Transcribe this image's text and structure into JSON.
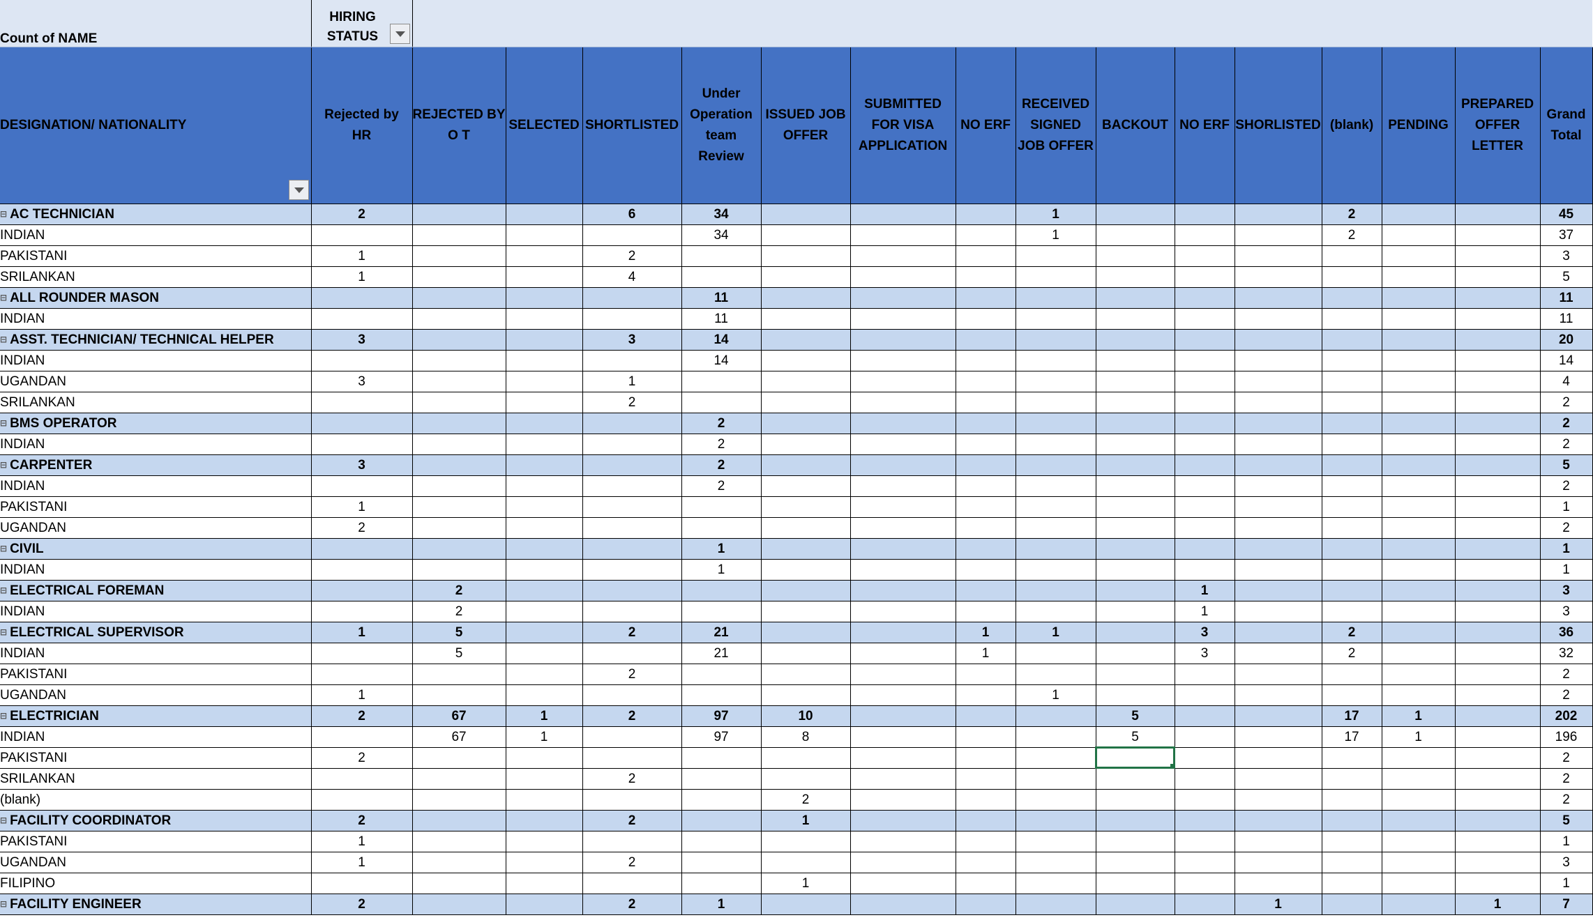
{
  "pivot": {
    "count_label": "Count of NAME",
    "status_label": [
      "HIRING",
      "STATUS"
    ],
    "row_header": "DESIGNATION/ NATIONALITY",
    "columns": [
      [
        "Rejected by",
        "HR"
      ],
      [
        "REJECTED BY",
        "O T"
      ],
      [
        "SELECTED"
      ],
      [
        "SHORTLISTED"
      ],
      [
        "Under",
        "Operation",
        "team",
        "Review"
      ],
      [
        "ISSUED JOB",
        "OFFER"
      ],
      [
        "SUBMITTED",
        "FOR VISA",
        "APPLICATION"
      ],
      [
        "NO ERF"
      ],
      [
        "RECEIVED",
        "SIGNED",
        "JOB OFFER"
      ],
      [
        "BACKOUT"
      ],
      [
        "NO ERF"
      ],
      [
        "SHORLISTED"
      ],
      [
        "(blank)"
      ],
      [
        "PENDING"
      ],
      [
        "PREPARED",
        "OFFER",
        "LETTER"
      ],
      [
        "Grand",
        "Total"
      ]
    ],
    "rows": [
      {
        "type": "group",
        "label": "AC TECHNICIAN",
        "cells": [
          "2",
          "",
          "",
          "6",
          "34",
          "",
          "",
          "",
          "1",
          "",
          "",
          "",
          "2",
          "",
          "",
          "45"
        ]
      },
      {
        "type": "sub",
        "label": "INDIAN",
        "cells": [
          "",
          "",
          "",
          "",
          "34",
          "",
          "",
          "",
          "1",
          "",
          "",
          "",
          "2",
          "",
          "",
          "37"
        ]
      },
      {
        "type": "sub",
        "label": "PAKISTANI",
        "cells": [
          "1",
          "",
          "",
          "2",
          "",
          "",
          "",
          "",
          "",
          "",
          "",
          "",
          "",
          "",
          "",
          "3"
        ]
      },
      {
        "type": "sub",
        "label": "SRILANKAN",
        "cells": [
          "1",
          "",
          "",
          "4",
          "",
          "",
          "",
          "",
          "",
          "",
          "",
          "",
          "",
          "",
          "",
          "5"
        ]
      },
      {
        "type": "group",
        "label": "ALL ROUNDER MASON",
        "cells": [
          "",
          "",
          "",
          "",
          "11",
          "",
          "",
          "",
          "",
          "",
          "",
          "",
          "",
          "",
          "",
          "11"
        ]
      },
      {
        "type": "sub",
        "label": "INDIAN",
        "cells": [
          "",
          "",
          "",
          "",
          "11",
          "",
          "",
          "",
          "",
          "",
          "",
          "",
          "",
          "",
          "",
          "11"
        ]
      },
      {
        "type": "group",
        "label": "ASST. TECHNICIAN/ TECHNICAL HELPER",
        "cells": [
          "3",
          "",
          "",
          "3",
          "14",
          "",
          "",
          "",
          "",
          "",
          "",
          "",
          "",
          "",
          "",
          "20"
        ]
      },
      {
        "type": "sub",
        "label": "INDIAN",
        "cells": [
          "",
          "",
          "",
          "",
          "14",
          "",
          "",
          "",
          "",
          "",
          "",
          "",
          "",
          "",
          "",
          "14"
        ]
      },
      {
        "type": "sub",
        "label": "UGANDAN",
        "cells": [
          "3",
          "",
          "",
          "1",
          "",
          "",
          "",
          "",
          "",
          "",
          "",
          "",
          "",
          "",
          "",
          "4"
        ]
      },
      {
        "type": "sub",
        "label": "SRILANKAN",
        "cells": [
          "",
          "",
          "",
          "2",
          "",
          "",
          "",
          "",
          "",
          "",
          "",
          "",
          "",
          "",
          "",
          "2"
        ]
      },
      {
        "type": "group",
        "label": "BMS OPERATOR",
        "cells": [
          "",
          "",
          "",
          "",
          "2",
          "",
          "",
          "",
          "",
          "",
          "",
          "",
          "",
          "",
          "",
          "2"
        ]
      },
      {
        "type": "sub",
        "label": "INDIAN",
        "cells": [
          "",
          "",
          "",
          "",
          "2",
          "",
          "",
          "",
          "",
          "",
          "",
          "",
          "",
          "",
          "",
          "2"
        ]
      },
      {
        "type": "group",
        "label": "CARPENTER",
        "cells": [
          "3",
          "",
          "",
          "",
          "2",
          "",
          "",
          "",
          "",
          "",
          "",
          "",
          "",
          "",
          "",
          "5"
        ]
      },
      {
        "type": "sub",
        "label": "INDIAN",
        "cells": [
          "",
          "",
          "",
          "",
          "2",
          "",
          "",
          "",
          "",
          "",
          "",
          "",
          "",
          "",
          "",
          "2"
        ]
      },
      {
        "type": "sub",
        "label": "PAKISTANI",
        "cells": [
          "1",
          "",
          "",
          "",
          "",
          "",
          "",
          "",
          "",
          "",
          "",
          "",
          "",
          "",
          "",
          "1"
        ]
      },
      {
        "type": "sub",
        "label": "UGANDAN",
        "cells": [
          "2",
          "",
          "",
          "",
          "",
          "",
          "",
          "",
          "",
          "",
          "",
          "",
          "",
          "",
          "",
          "2"
        ]
      },
      {
        "type": "group",
        "label": "CIVIL",
        "cells": [
          "",
          "",
          "",
          "",
          "1",
          "",
          "",
          "",
          "",
          "",
          "",
          "",
          "",
          "",
          "",
          "1"
        ]
      },
      {
        "type": "sub",
        "label": "INDIAN",
        "cells": [
          "",
          "",
          "",
          "",
          "1",
          "",
          "",
          "",
          "",
          "",
          "",
          "",
          "",
          "",
          "",
          "1"
        ]
      },
      {
        "type": "group",
        "label": "ELECTRICAL FOREMAN",
        "cells": [
          "",
          "2",
          "",
          "",
          "",
          "",
          "",
          "",
          "",
          "",
          "1",
          "",
          "",
          "",
          "",
          "3"
        ]
      },
      {
        "type": "sub",
        "label": "INDIAN",
        "cells": [
          "",
          "2",
          "",
          "",
          "",
          "",
          "",
          "",
          "",
          "",
          "1",
          "",
          "",
          "",
          "",
          "3"
        ]
      },
      {
        "type": "group",
        "label": "ELECTRICAL SUPERVISOR",
        "cells": [
          "1",
          "5",
          "",
          "2",
          "21",
          "",
          "",
          "1",
          "1",
          "",
          "3",
          "",
          "2",
          "",
          "",
          "36"
        ]
      },
      {
        "type": "sub",
        "label": "INDIAN",
        "cells": [
          "",
          "5",
          "",
          "",
          "21",
          "",
          "",
          "1",
          "",
          "",
          "3",
          "",
          "2",
          "",
          "",
          "32"
        ]
      },
      {
        "type": "sub",
        "label": "PAKISTANI",
        "cells": [
          "",
          "",
          "",
          "2",
          "",
          "",
          "",
          "",
          "",
          "",
          "",
          "",
          "",
          "",
          "",
          "2"
        ]
      },
      {
        "type": "sub",
        "label": "UGANDAN",
        "cells": [
          "1",
          "",
          "",
          "",
          "",
          "",
          "",
          "",
          "1",
          "",
          "",
          "",
          "",
          "",
          "",
          "2"
        ]
      },
      {
        "type": "group",
        "label": "ELECTRICIAN",
        "cells": [
          "2",
          "67",
          "1",
          "2",
          "97",
          "10",
          "",
          "",
          "",
          "5",
          "",
          "",
          "17",
          "1",
          "",
          "202"
        ]
      },
      {
        "type": "sub",
        "label": "INDIAN",
        "cells": [
          "",
          "67",
          "1",
          "",
          "97",
          "8",
          "",
          "",
          "",
          "5",
          "",
          "",
          "17",
          "1",
          "",
          "196"
        ]
      },
      {
        "type": "sub",
        "label": "PAKISTANI",
        "cells": [
          "2",
          "",
          "",
          "",
          "",
          "",
          "",
          "",
          "",
          "",
          "",
          "",
          "",
          "",
          "",
          "2"
        ]
      },
      {
        "type": "sub",
        "label": "SRILANKAN",
        "cells": [
          "",
          "",
          "",
          "2",
          "",
          "",
          "",
          "",
          "",
          "",
          "",
          "",
          "",
          "",
          "",
          "2"
        ]
      },
      {
        "type": "sub",
        "label": "(blank)",
        "cells": [
          "",
          "",
          "",
          "",
          "",
          "2",
          "",
          "",
          "",
          "",
          "",
          "",
          "",
          "",
          "",
          "2"
        ]
      },
      {
        "type": "group",
        "label": "FACILITY COORDINATOR",
        "cells": [
          "2",
          "",
          "",
          "2",
          "",
          "1",
          "",
          "",
          "",
          "",
          "",
          "",
          "",
          "",
          "",
          "5"
        ]
      },
      {
        "type": "sub",
        "label": "PAKISTANI",
        "cells": [
          "1",
          "",
          "",
          "",
          "",
          "",
          "",
          "",
          "",
          "",
          "",
          "",
          "",
          "",
          "",
          "1"
        ]
      },
      {
        "type": "sub",
        "label": "UGANDAN",
        "cells": [
          "1",
          "",
          "",
          "2",
          "",
          "",
          "",
          "",
          "",
          "",
          "",
          "",
          "",
          "",
          "",
          "3"
        ]
      },
      {
        "type": "sub",
        "label": "FILIPINO",
        "cells": [
          "",
          "",
          "",
          "",
          "",
          "1",
          "",
          "",
          "",
          "",
          "",
          "",
          "",
          "",
          "",
          "1"
        ]
      },
      {
        "type": "group",
        "label": "FACILITY ENGINEER",
        "cells": [
          "2",
          "",
          "",
          "2",
          "1",
          "",
          "",
          "",
          "",
          "",
          "",
          "1",
          "",
          "",
          "1",
          "7"
        ]
      }
    ]
  },
  "selection": {
    "row": 26,
    "col": 9
  },
  "colors": {
    "header_blue": "#4472c4",
    "group_row": "#c5d7ef",
    "top_header": "#dde6f3",
    "excel_green": "#217346"
  }
}
